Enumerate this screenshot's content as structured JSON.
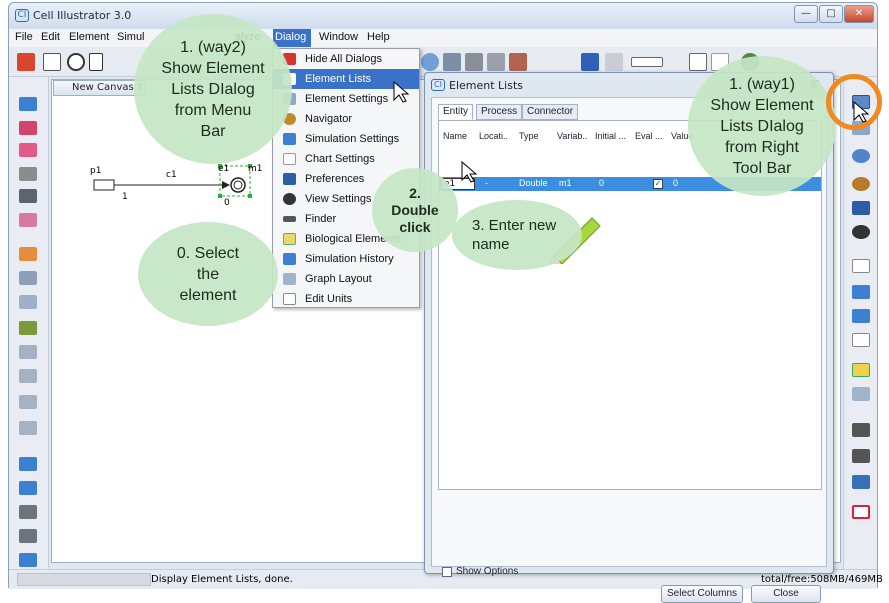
{
  "window": {
    "title": "Cell Illustrator 3.0",
    "app_icon": "CI"
  },
  "menubar": {
    "items": [
      {
        "label": "File"
      },
      {
        "label": "Edit"
      },
      {
        "label": "Element"
      },
      {
        "label": "Simul"
      },
      {
        "label": "alyze"
      },
      {
        "label": "Dialog"
      },
      {
        "label": "Window"
      },
      {
        "label": "Help"
      }
    ]
  },
  "canvas": {
    "tab_label": "New Canvas 1",
    "nodes": {
      "p1": "p1",
      "c1": "c1",
      "e1": "e1",
      "m1": "m1",
      "one": "1",
      "zero": "0"
    }
  },
  "dialog_menu": {
    "items": [
      {
        "label": "Hide All Dialogs",
        "icon": "hide-dialogs-icon"
      },
      {
        "label": "Element Lists",
        "icon": "element-lists-icon"
      },
      {
        "label": "Element Settings",
        "icon": "element-settings-icon"
      },
      {
        "label": "Navigator",
        "icon": "navigator-icon"
      },
      {
        "label": "Simulation Settings",
        "icon": "simulation-settings-icon"
      },
      {
        "label": "Chart Settings",
        "icon": "chart-settings-icon"
      },
      {
        "label": "Preferences",
        "icon": "preferences-icon"
      },
      {
        "label": "View Settings",
        "icon": "view-settings-icon"
      },
      {
        "label": "Finder",
        "icon": "finder-icon"
      },
      {
        "label": "Biological Elements",
        "icon": "biological-elements-icon"
      },
      {
        "label": "Simulation History",
        "icon": "simulation-history-icon"
      },
      {
        "label": "Graph Layout",
        "icon": "graph-layout-icon"
      },
      {
        "label": "Edit Units",
        "icon": "edit-units-icon"
      }
    ]
  },
  "element_lists": {
    "title": "Element Lists",
    "close": "⊠",
    "tabs": [
      "Entity",
      "Process",
      "Connector"
    ],
    "columns": [
      "Name",
      "Locati..",
      "Type",
      "Variab..",
      "Initial ...",
      "Eval ...",
      "Value"
    ],
    "row": {
      "name": "e1",
      "location": "-",
      "type": "Double",
      "variable": "m1",
      "initial": "0",
      "eval": "✓",
      "value": "0"
    },
    "show_options": "Show Options",
    "select_columns": "Select Columns",
    "close_button": "Close"
  },
  "status": {
    "message": "Display Element Lists, done.",
    "memory": "total/free:508MB/469MB"
  },
  "callouts": {
    "way2": "1. (way2)\nShow Element\nLists DIalog\nfrom Menu\nBar",
    "way1": "1. (way1)\nShow Element\nLists DIalog\nfrom Right\nTool Bar",
    "select": "0. Select\nthe\nelement",
    "double_click": "2.\nDouble\nclick",
    "enter": "3. Enter new\nname"
  },
  "colors": {
    "accent": "#3b72c9",
    "selection": "#3b8ee0",
    "callout": "#c4e6c4",
    "ring": "#f08a1e"
  }
}
